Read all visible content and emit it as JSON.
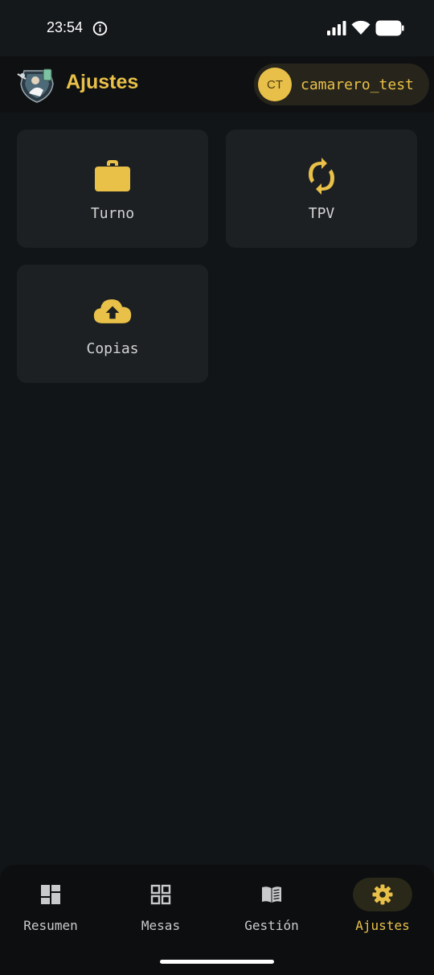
{
  "status": {
    "time": "23:54"
  },
  "header": {
    "title": "Ajustes",
    "user_initials": "CT",
    "user_name": "camarero_test"
  },
  "tiles": [
    {
      "label": "Turno",
      "icon": "briefcase-icon"
    },
    {
      "label": "TPV",
      "icon": "sync-icon"
    },
    {
      "label": "Copias",
      "icon": "cloud-upload-icon"
    }
  ],
  "nav": {
    "items": [
      {
        "label": "Resumen",
        "icon": "dashboard-icon"
      },
      {
        "label": "Mesas",
        "icon": "grid-icon"
      },
      {
        "label": "Gestión",
        "icon": "book-icon"
      },
      {
        "label": "Ajustes",
        "icon": "gear-icon"
      }
    ],
    "active": "Ajustes"
  },
  "colors": {
    "accent": "#e9c149",
    "background": "#121518",
    "tile": "#1d2023",
    "nav_background": "#0c0e10"
  }
}
